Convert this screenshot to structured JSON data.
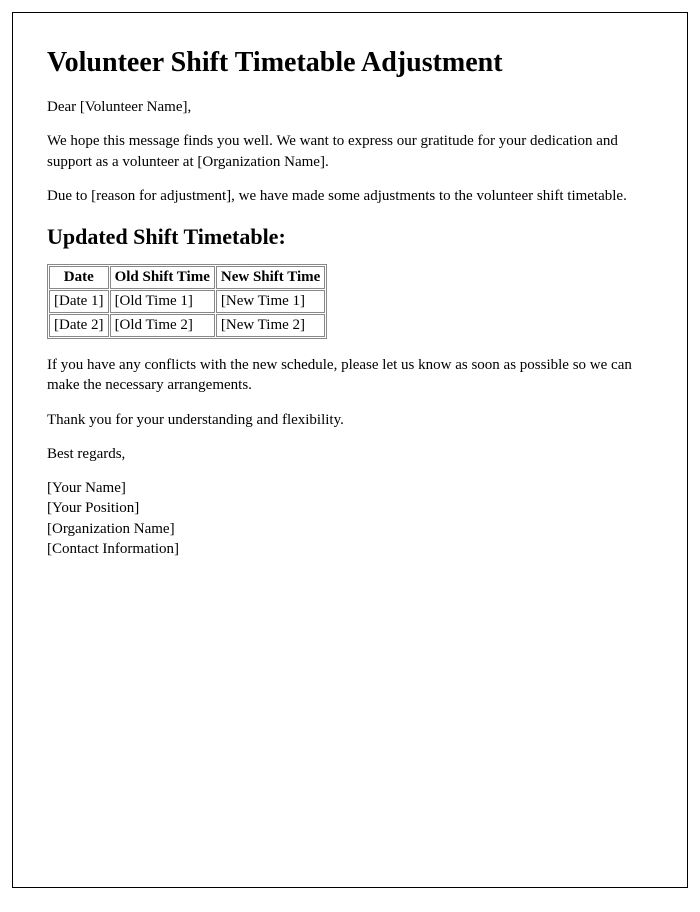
{
  "title": "Volunteer Shift Timetable Adjustment",
  "greeting": "Dear [Volunteer Name],",
  "para1": "We hope this message finds you well. We want to express our gratitude for your dedication and support as a volunteer at [Organization Name].",
  "para2": "Due to [reason for adjustment], we have made some adjustments to the volunteer shift timetable.",
  "subheading": "Updated Shift Timetable:",
  "table": {
    "headers": {
      "date": "Date",
      "old": "Old Shift Time",
      "new": "New Shift Time"
    },
    "rows": [
      {
        "date": "[Date 1]",
        "old": "[Old Time 1]",
        "new": "[New Time 1]"
      },
      {
        "date": "[Date 2]",
        "old": "[Old Time 2]",
        "new": "[New Time 2]"
      }
    ]
  },
  "para3": "If you have any conflicts with the new schedule, please let us know as soon as possible so we can make the necessary arrangements.",
  "para4": "Thank you for your understanding and flexibility.",
  "closing": "Best regards,",
  "signature": {
    "name": "[Your Name]",
    "position": "[Your Position]",
    "org": "[Organization Name]",
    "contact": "[Contact Information]"
  }
}
